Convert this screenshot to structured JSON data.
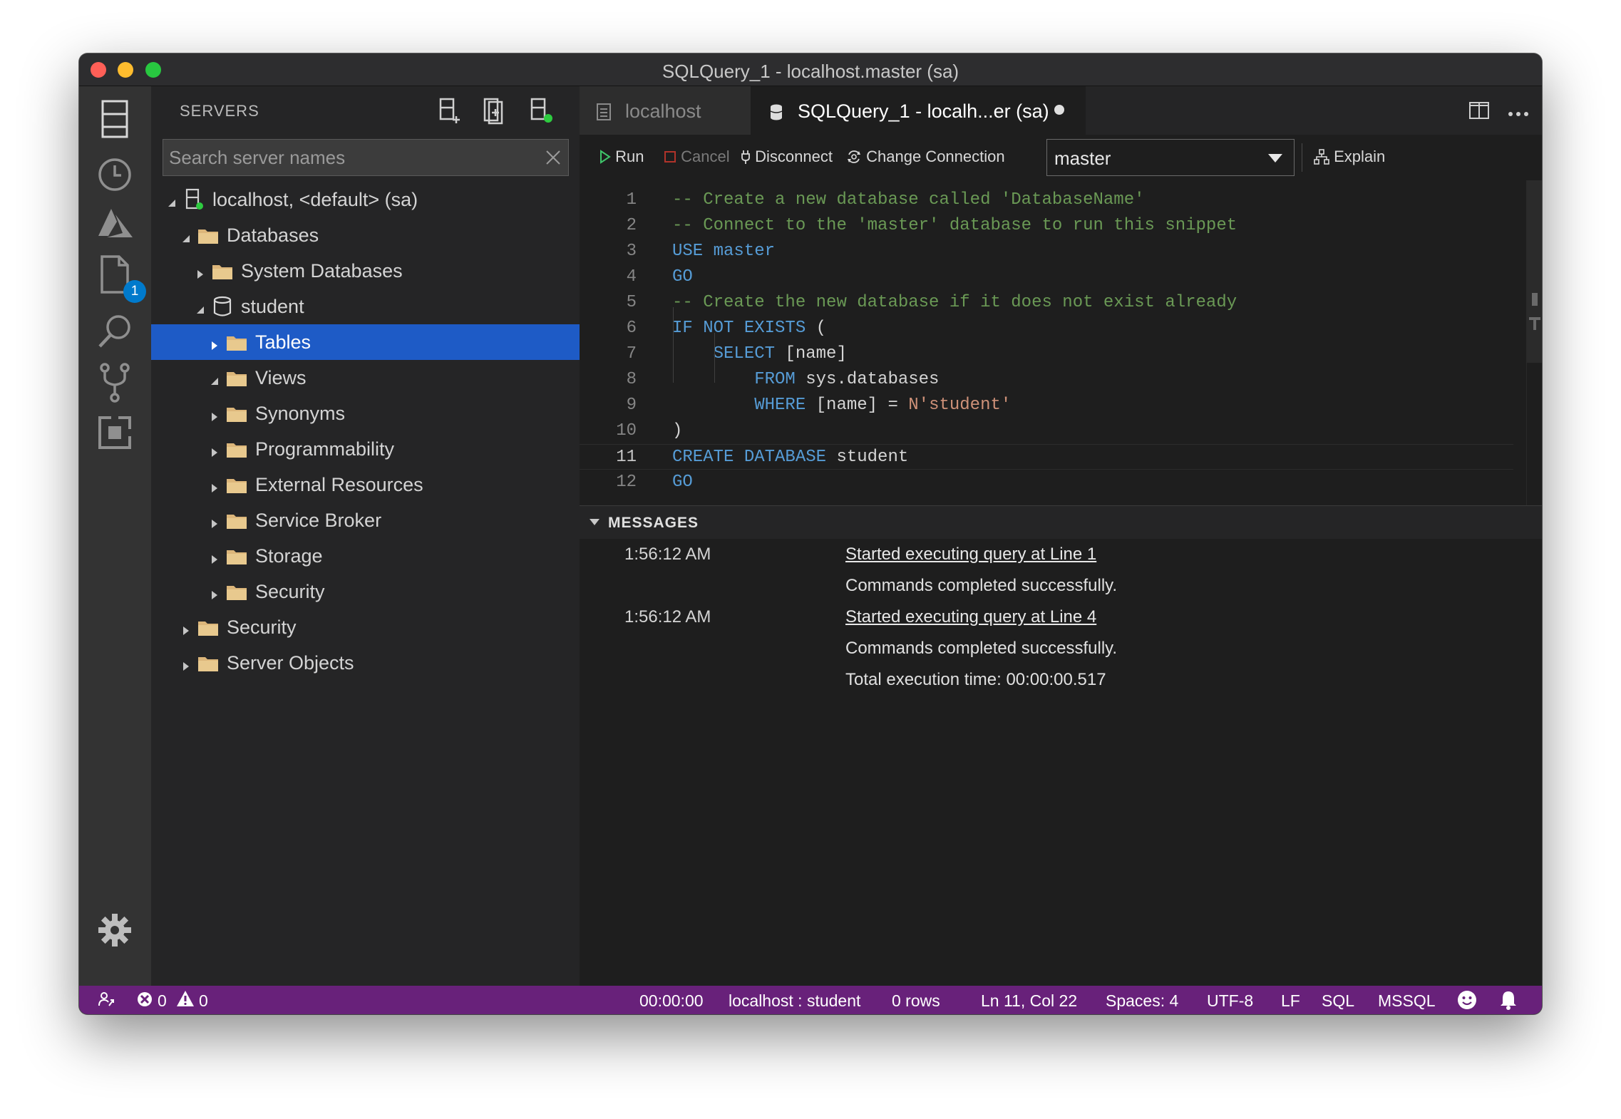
{
  "window": {
    "title": "SQLQuery_1 - localhost.master (sa)"
  },
  "activitybar": {
    "items": [
      "servers-icon",
      "history-icon",
      "azure-icon",
      "explorer-icon",
      "search-icon",
      "source-control-icon",
      "extensions-icon"
    ],
    "explorer_badge": "1"
  },
  "sidebar": {
    "title": "SERVERS",
    "search_placeholder": "Search server names",
    "tree": [
      {
        "label": "localhost, <default> (sa)",
        "icon": "server-icon",
        "state": "expanded"
      },
      {
        "label": "Databases",
        "icon": "folder-icon",
        "state": "expanded"
      },
      {
        "label": "System Databases",
        "icon": "folder-icon",
        "state": "collapsed"
      },
      {
        "label": "student",
        "icon": "database-icon",
        "state": "expanded"
      },
      {
        "label": "Tables",
        "icon": "folder-icon",
        "state": "collapsed",
        "selected": true
      },
      {
        "label": "Views",
        "icon": "folder-icon",
        "state": "expanded"
      },
      {
        "label": "Synonyms",
        "icon": "folder-icon",
        "state": "collapsed"
      },
      {
        "label": "Programmability",
        "icon": "folder-icon",
        "state": "collapsed"
      },
      {
        "label": "External Resources",
        "icon": "folder-icon",
        "state": "collapsed"
      },
      {
        "label": "Service Broker",
        "icon": "folder-icon",
        "state": "collapsed"
      },
      {
        "label": "Storage",
        "icon": "folder-icon",
        "state": "collapsed"
      },
      {
        "label": "Security",
        "icon": "folder-icon",
        "state": "collapsed"
      },
      {
        "label": "Security",
        "icon": "folder-icon",
        "state": "collapsed"
      },
      {
        "label": "Server Objects",
        "icon": "folder-icon",
        "state": "collapsed"
      }
    ]
  },
  "tabs": [
    {
      "label": "localhost",
      "icon": "document-icon",
      "active": false
    },
    {
      "label": "SQLQuery_1 - localh...er (sa)",
      "icon": "database-icon",
      "active": true,
      "dirty": true
    }
  ],
  "toolbar": {
    "run": "Run",
    "cancel": "Cancel",
    "disconnect": "Disconnect",
    "change_connection": "Change Connection",
    "database": "master",
    "explain": "Explain"
  },
  "code": {
    "current_line": 11,
    "lines": [
      {
        "n": "1",
        "segs": [
          {
            "t": "-- Create a new database called 'DatabaseName'",
            "c": "comment"
          }
        ]
      },
      {
        "n": "2",
        "segs": [
          {
            "t": "-- Connect to the 'master' database to run this snippet",
            "c": "comment"
          }
        ]
      },
      {
        "n": "3",
        "segs": [
          {
            "t": "USE",
            "c": "kw"
          },
          {
            "t": " ",
            "c": ""
          },
          {
            "t": "master",
            "c": "kw"
          }
        ]
      },
      {
        "n": "4",
        "segs": [
          {
            "t": "GO",
            "c": "kw"
          }
        ]
      },
      {
        "n": "5",
        "segs": [
          {
            "t": "-- Create the new database if it does not exist already",
            "c": "comment"
          }
        ]
      },
      {
        "n": "6",
        "segs": [
          {
            "t": "IF NOT EXISTS",
            "c": "kw"
          },
          {
            "t": " (",
            "c": ""
          }
        ]
      },
      {
        "n": "7",
        "segs": [
          {
            "t": "    ",
            "c": ""
          },
          {
            "t": "SELECT",
            "c": "kw"
          },
          {
            "t": " [name]",
            "c": ""
          }
        ]
      },
      {
        "n": "8",
        "segs": [
          {
            "t": "        ",
            "c": ""
          },
          {
            "t": "FROM",
            "c": "kw"
          },
          {
            "t": " sys.databases",
            "c": ""
          }
        ]
      },
      {
        "n": "9",
        "segs": [
          {
            "t": "        ",
            "c": ""
          },
          {
            "t": "WHERE",
            "c": "kw"
          },
          {
            "t": " [name] = ",
            "c": ""
          },
          {
            "t": "N'student'",
            "c": "str"
          }
        ]
      },
      {
        "n": "10",
        "segs": [
          {
            "t": ")",
            "c": ""
          }
        ]
      },
      {
        "n": "11",
        "segs": [
          {
            "t": "CREATE DATABASE",
            "c": "kw"
          },
          {
            "t": " student",
            "c": ""
          }
        ]
      },
      {
        "n": "12",
        "segs": [
          {
            "t": "GO",
            "c": "kw"
          }
        ]
      }
    ]
  },
  "messages": {
    "title": "MESSAGES",
    "rows": [
      {
        "time": "1:56:12 AM",
        "text": "Started executing query at Line 1",
        "link": true
      },
      {
        "time": "",
        "text": "Commands completed successfully.",
        "link": false
      },
      {
        "time": "1:56:12 AM",
        "text": "Started executing query at Line 4",
        "link": true
      },
      {
        "time": "",
        "text": "Commands completed successfully.",
        "link": false
      },
      {
        "time": "",
        "text": "Total execution time: 00:00:00.517",
        "link": false
      }
    ]
  },
  "statusbar": {
    "errors": "0",
    "warnings": "0",
    "elapsed": "00:00:00",
    "connection": "localhost : student",
    "rows": "0 rows",
    "position": "Ln 11, Col 22",
    "spaces": "Spaces: 4",
    "encoding": "UTF-8",
    "eol": "LF",
    "language": "SQL",
    "provider": "MSSQL",
    "color": "#68217a"
  },
  "colors": {
    "selection": "#1e5bc6",
    "keyword": "#569cd6",
    "comment": "#6a9955",
    "string": "#ce9178"
  }
}
